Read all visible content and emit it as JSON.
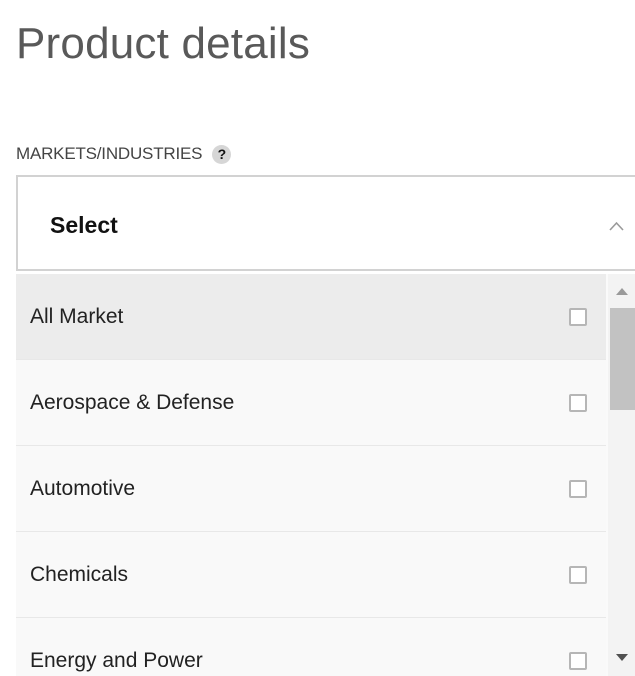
{
  "page": {
    "title": "Product details"
  },
  "field": {
    "label": "MARKETS/INDUSTRIES",
    "help_icon": "?",
    "selected_value": "Select",
    "expanded": true
  },
  "options": [
    {
      "label": "All Market",
      "checked": false,
      "hovered": true
    },
    {
      "label": "Aerospace & Defense",
      "checked": false
    },
    {
      "label": "Automotive",
      "checked": false
    },
    {
      "label": "Chemicals",
      "checked": false
    },
    {
      "label": "Energy and Power",
      "checked": false
    }
  ],
  "icons": {
    "help": "question-icon",
    "toggle": "chevron-up-icon",
    "checkbox": "checkbox-icon"
  }
}
